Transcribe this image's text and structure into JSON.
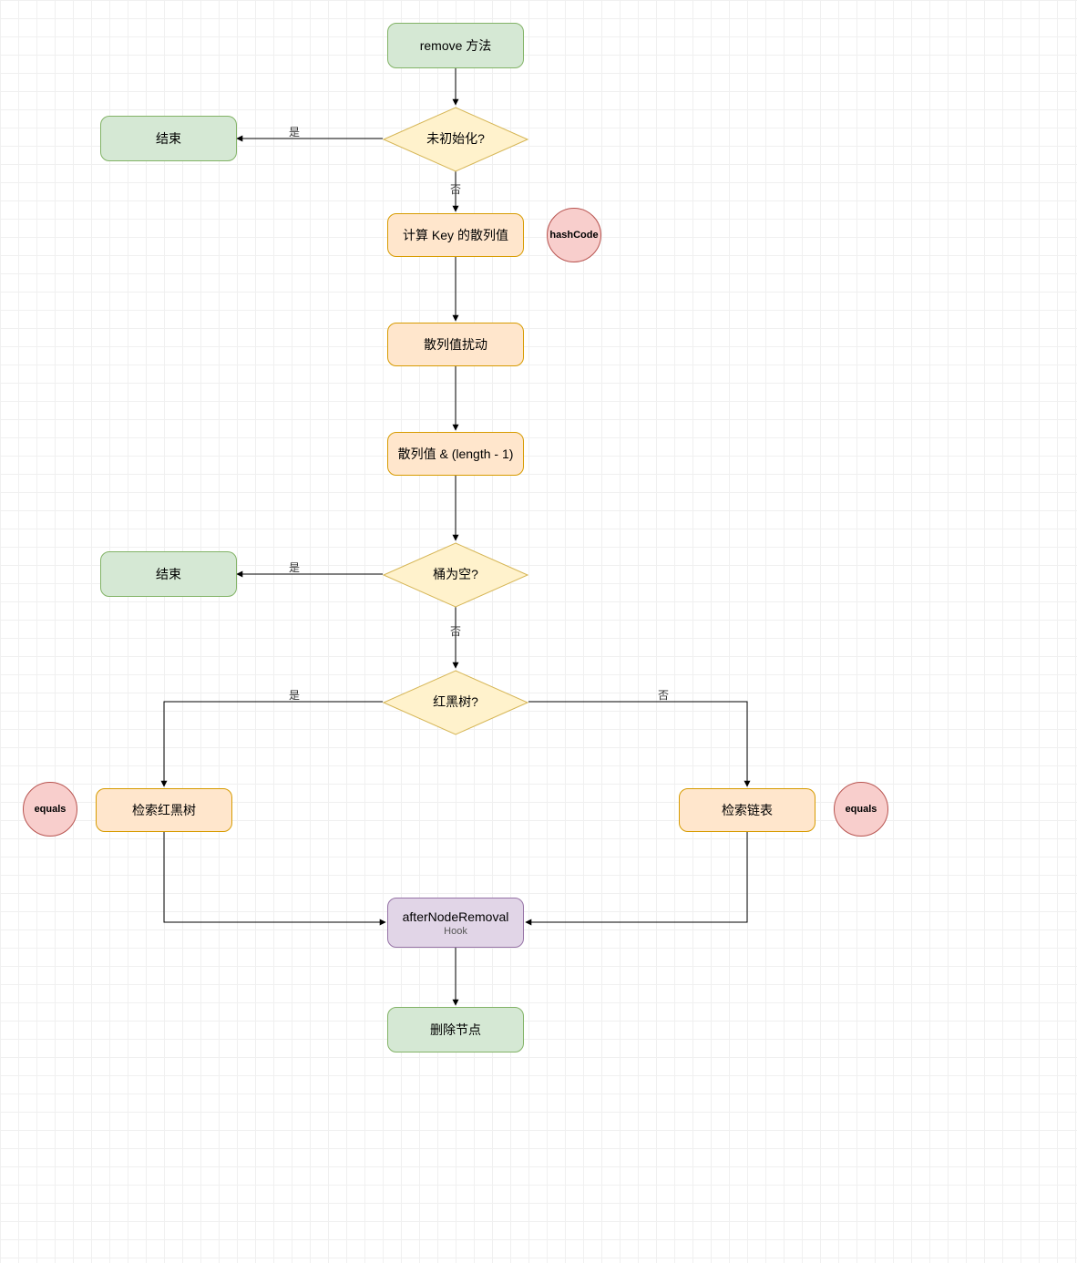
{
  "nodes": {
    "start": {
      "label": "remove 方法"
    },
    "end1": {
      "label": "结束"
    },
    "d1": {
      "label": "未初始化?"
    },
    "p1": {
      "label": "计算 Key 的散列值"
    },
    "c1": {
      "label": "hashCode"
    },
    "p2": {
      "label": "散列值扰动"
    },
    "p3": {
      "label": "散列值 & (length - 1)"
    },
    "end2": {
      "label": "结束"
    },
    "d2": {
      "label": "桶为空?"
    },
    "d3": {
      "label": "红黑树?"
    },
    "p4": {
      "label": "检索红黑树"
    },
    "p5": {
      "label": "检索链表"
    },
    "c2": {
      "label": "equals"
    },
    "c3": {
      "label": "equals"
    },
    "p6": {
      "label": "afterNodeRemoval",
      "sub": "Hook"
    },
    "end3": {
      "label": "删除节点"
    }
  },
  "edges": {
    "yes": "是",
    "no": "否"
  }
}
